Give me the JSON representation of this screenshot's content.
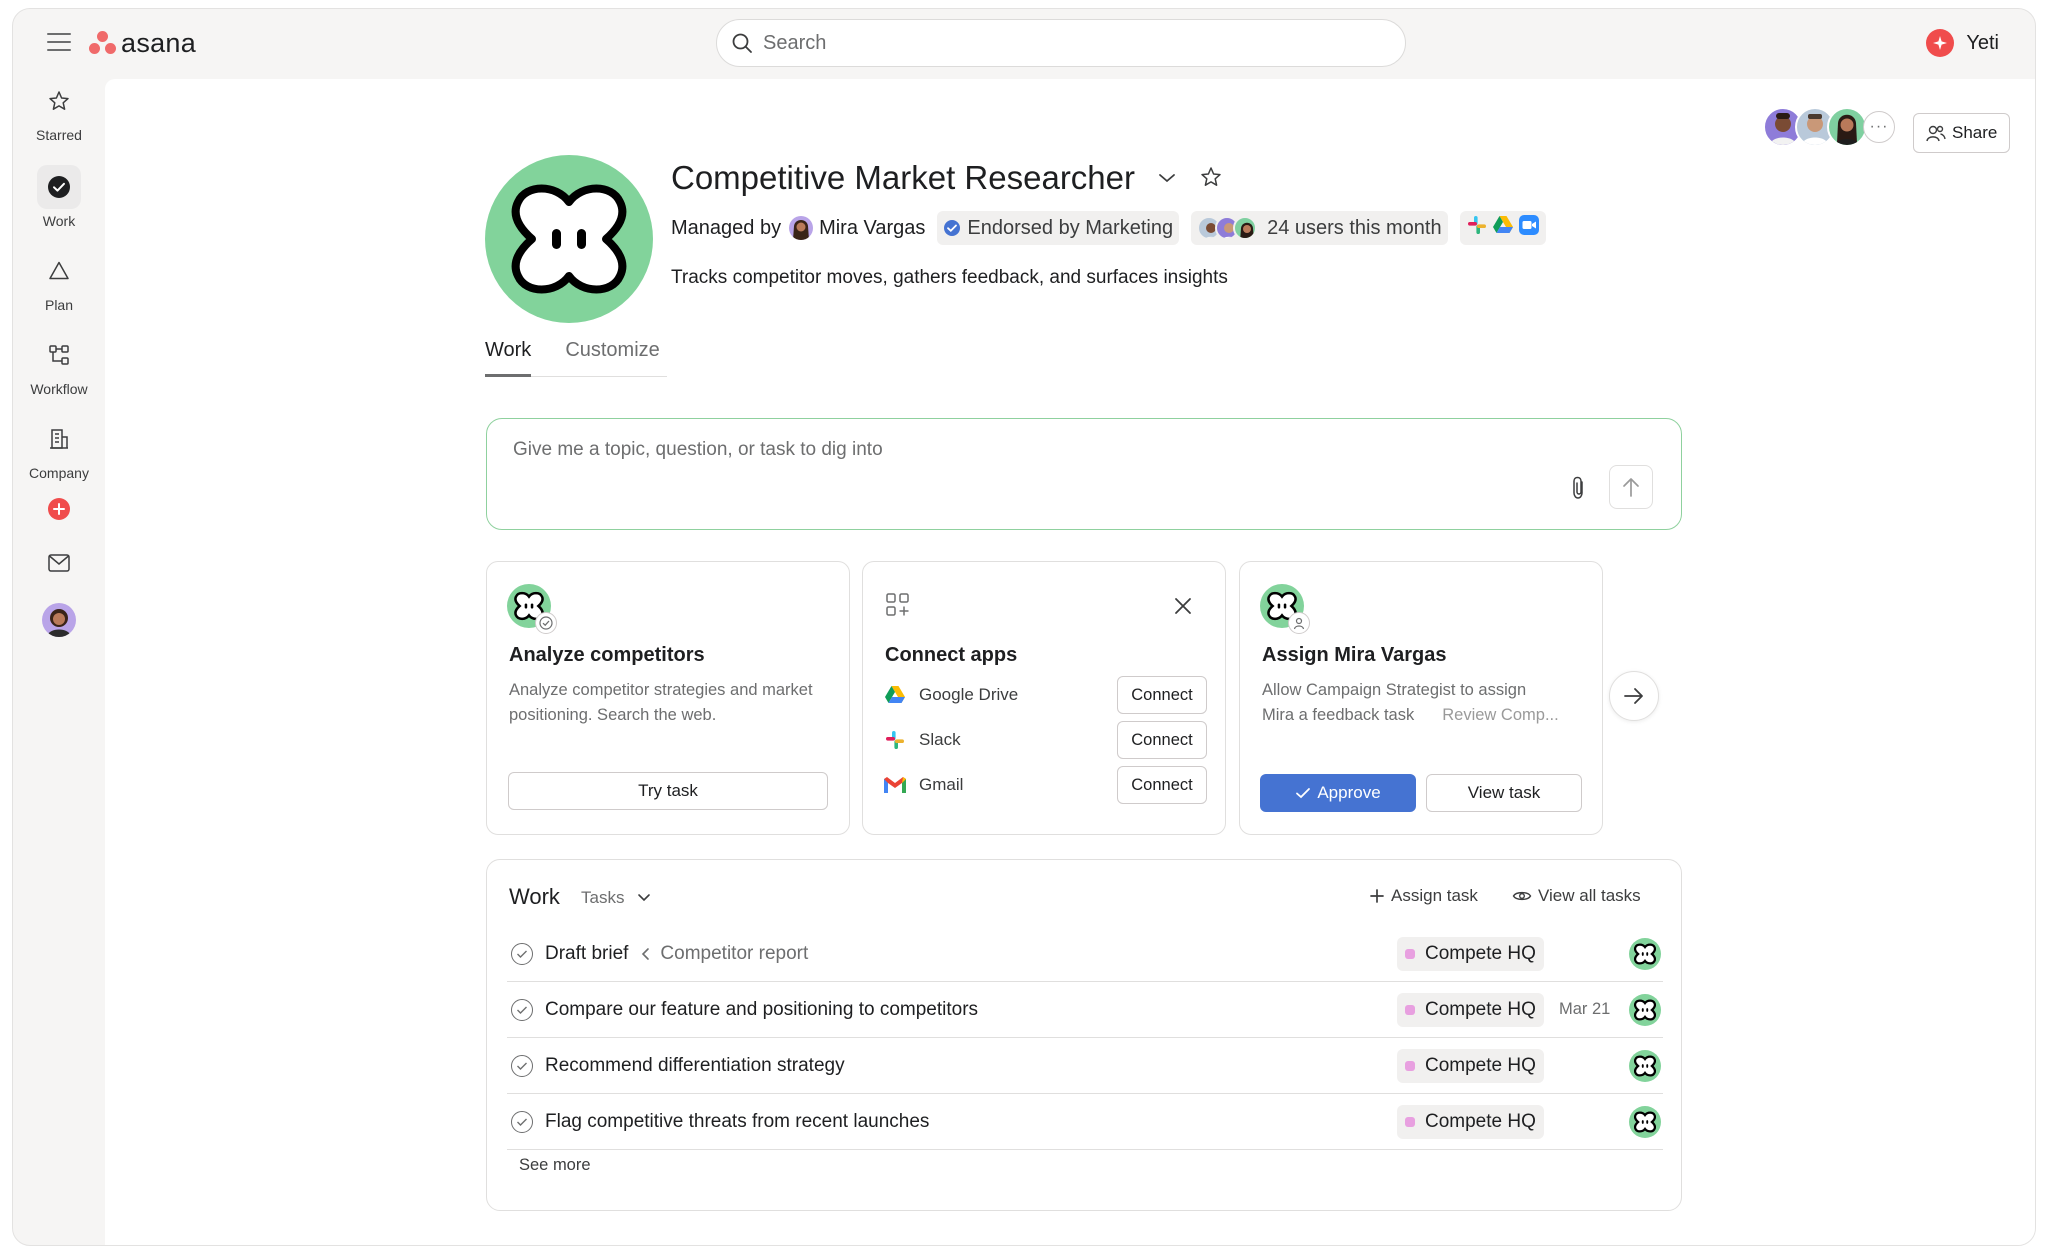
{
  "app": {
    "name": "asana",
    "brand_color": "#f06a6a"
  },
  "search": {
    "placeholder": "Search"
  },
  "workspace": {
    "name": "Yeti",
    "color": "#f04c4c"
  },
  "sidebar": {
    "items": [
      {
        "label": "Starred",
        "icon": "star-icon"
      },
      {
        "label": "Work",
        "icon": "check-circle-icon",
        "active": true
      },
      {
        "label": "Plan",
        "icon": "triangle-icon"
      },
      {
        "label": "Workflow",
        "icon": "workflow-icon"
      },
      {
        "label": "Company",
        "icon": "building-icon"
      }
    ]
  },
  "header": {
    "share_label": "Share",
    "more_label": "···"
  },
  "agent": {
    "title": "Competitive Market Researcher",
    "managed_by_label": "Managed by",
    "manager_name": "Mira Vargas",
    "endorsement": "Endorsed by Marketing",
    "users_text": "24 users this month",
    "description": "Tracks competitor moves, gathers feedback, and surfaces insights",
    "logo_color": "#82d39b"
  },
  "tabs": [
    {
      "label": "Work",
      "active": true
    },
    {
      "label": "Customize",
      "active": false
    }
  ],
  "prompt": {
    "placeholder": "Give me a topic, question, or task to dig into"
  },
  "cards": {
    "analyze": {
      "title": "Analyze competitors",
      "description": "Analyze competitor strategies and market positioning. Search the web.",
      "button": "Try task"
    },
    "connect": {
      "title": "Connect apps",
      "apps": [
        {
          "name": "Google Drive",
          "button": "Connect"
        },
        {
          "name": "Slack",
          "button": "Connect"
        },
        {
          "name": "Gmail",
          "button": "Connect"
        }
      ]
    },
    "assign": {
      "title": "Assign Mira Vargas",
      "description_line1": "Allow Campaign Strategist to assign",
      "description_line2": "Mira a feedback task",
      "task_preview": "Review Comp...",
      "approve": "Approve",
      "view": "View task"
    }
  },
  "work": {
    "title": "Work",
    "filter": "Tasks",
    "assign_task": "Assign task",
    "view_all": "View all tasks",
    "see_more": "See more",
    "tasks": [
      {
        "name": "Draft brief",
        "parent": "Competitor report",
        "project": "Compete HQ",
        "due": ""
      },
      {
        "name": "Compare our feature and positioning to competitors",
        "parent": "",
        "project": "Compete HQ",
        "due": "Mar 21"
      },
      {
        "name": "Recommend differentiation strategy",
        "parent": "",
        "project": "Compete HQ",
        "due": ""
      },
      {
        "name": "Flag competitive threats from recent launches",
        "parent": "",
        "project": "Compete HQ",
        "due": ""
      }
    ]
  },
  "colors": {
    "accent": "#4573d2",
    "project_chip": "#e8a0e0",
    "agent_green": "#82d39b"
  }
}
